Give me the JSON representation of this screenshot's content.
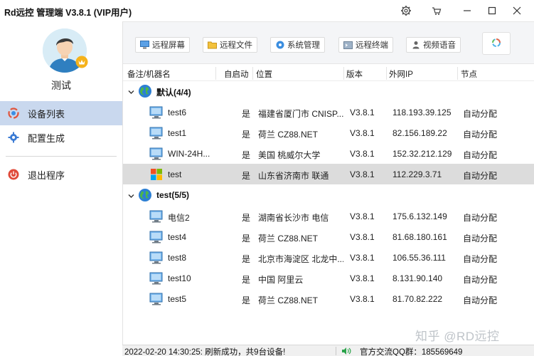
{
  "window": {
    "title": "Rd远控  管理端 V3.8.1 (VIP用户)"
  },
  "sidebar": {
    "username": "测试",
    "items": [
      {
        "label": "设备列表",
        "icon": "device-list-icon",
        "active": true
      },
      {
        "label": "配置生成",
        "icon": "gear-icon",
        "active": false
      },
      {
        "label": "退出程序",
        "icon": "power-icon",
        "active": false
      }
    ]
  },
  "toolbar": {
    "remote_screen": "远程屏幕",
    "remote_file": "远程文件",
    "system_manage": "系统管理",
    "remote_terminal": "远程终端",
    "video_audio": "视频语音"
  },
  "table": {
    "headers": [
      "备注/机器名",
      "自启动",
      "位置",
      "版本",
      "外网IP",
      "节点"
    ],
    "groups": [
      {
        "name": "默认(4/4)",
        "rows": [
          {
            "name": "test6",
            "autostart": "是",
            "location": "福建省厦门市 CNISP...",
            "version": "V3.8.1",
            "ip": "118.193.39.125",
            "node": "自动分配",
            "selected": false,
            "os": "pc"
          },
          {
            "name": "test1",
            "autostart": "是",
            "location": "荷兰  CZ88.NET",
            "version": "V3.8.1",
            "ip": "82.156.189.22",
            "node": "自动分配",
            "selected": false,
            "os": "pc"
          },
          {
            "name": "WIN-24H...",
            "autostart": "是",
            "location": "美国 桃威尔大学",
            "version": "V3.8.1",
            "ip": "152.32.212.129",
            "node": "自动分配",
            "selected": false,
            "os": "pc"
          },
          {
            "name": "test",
            "autostart": "是",
            "location": "山东省济南市 联通",
            "version": "V3.8.1",
            "ip": "112.229.3.71",
            "node": "自动分配",
            "selected": true,
            "os": "windows"
          }
        ]
      },
      {
        "name": "test(5/5)",
        "rows": [
          {
            "name": "电信2",
            "autostart": "是",
            "location": "湖南省长沙市 电信",
            "version": "V3.8.1",
            "ip": "175.6.132.149",
            "node": "自动分配",
            "selected": false,
            "os": "pc"
          },
          {
            "name": "test4",
            "autostart": "是",
            "location": "荷兰  CZ88.NET",
            "version": "V3.8.1",
            "ip": "81.68.180.161",
            "node": "自动分配",
            "selected": false,
            "os": "pc"
          },
          {
            "name": "test8",
            "autostart": "是",
            "location": "北京市海淀区 北龙中...",
            "version": "V3.8.1",
            "ip": "106.55.36.111",
            "node": "自动分配",
            "selected": false,
            "os": "pc"
          },
          {
            "name": "test10",
            "autostart": "是",
            "location": "中国 阿里云",
            "version": "V3.8.1",
            "ip": "8.131.90.140",
            "node": "自动分配",
            "selected": false,
            "os": "pc"
          },
          {
            "name": "test5",
            "autostart": "是",
            "location": "荷兰  CZ88.NET",
            "version": "V3.8.1",
            "ip": "81.70.82.222",
            "node": "自动分配",
            "selected": false,
            "os": "pc"
          }
        ]
      }
    ]
  },
  "status": {
    "message": "2022-02-20 14:30:25: 刷新成功，共9台设备!",
    "qq": "官方交流QQ群：185569649"
  },
  "watermark": "知乎 @RD远控",
  "colors": {
    "active_nav": "#c9d8ee",
    "selected_row": "#dcdcdc",
    "toolbar_bg": "#f4f5f7"
  }
}
